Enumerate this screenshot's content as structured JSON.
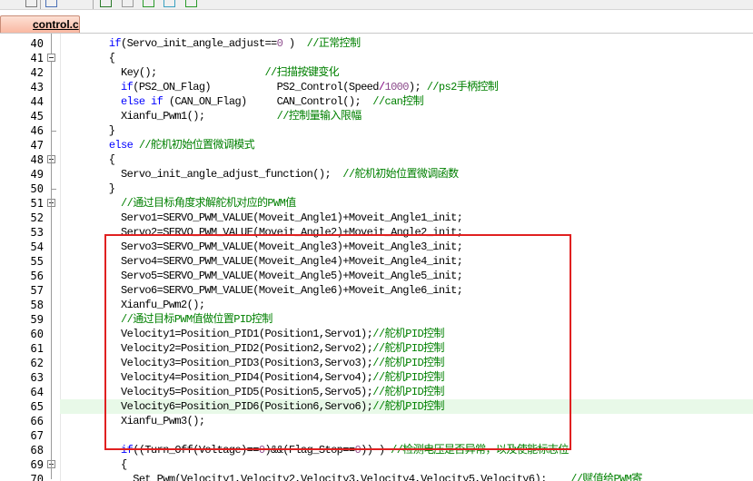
{
  "toolbar": {
    "icons": [
      "checkbox-dropdown-icon",
      "build-icon",
      "window-icon",
      "undo-icon",
      "download-icon",
      "debug-icon",
      "check-icon"
    ]
  },
  "tab": {
    "label": "control.c"
  },
  "accent_colors": {
    "keyword": "#0000ff",
    "comment": "#008000",
    "number": "#8b4a8b",
    "annotation": "#e02020",
    "current_line": "#e8f9e8"
  },
  "editor": {
    "lines": [
      {
        "n": "40",
        "tokens": [
          [
            "        ",
            ""
          ],
          [
            "if",
            "kw"
          ],
          [
            "(Servo_init_angle_adjust==",
            ""
          ],
          [
            "0",
            "nm"
          ],
          [
            " )  ",
            ""
          ],
          [
            "//正常控制",
            "cm"
          ]
        ]
      },
      {
        "n": "41",
        "tokens": [
          [
            "        {",
            ""
          ]
        ]
      },
      {
        "n": "42",
        "tokens": [
          [
            "          Key();                  ",
            ""
          ],
          [
            "//扫描按键变化",
            "cm"
          ]
        ]
      },
      {
        "n": "43",
        "tokens": [
          [
            "          ",
            ""
          ],
          [
            "if",
            "kw"
          ],
          [
            "(PS2_ON_Flag)           PS2_Control(Speed",
            ""
          ],
          [
            "/",
            "pn"
          ],
          [
            "1000",
            "nm"
          ],
          [
            "); ",
            ""
          ],
          [
            "//ps2手柄控制",
            "cm"
          ]
        ]
      },
      {
        "n": "44",
        "tokens": [
          [
            "          ",
            ""
          ],
          [
            "else",
            "kw"
          ],
          [
            " ",
            ""
          ],
          [
            "if",
            "kw"
          ],
          [
            " (CAN_ON_Flag)     CAN_Control();  ",
            ""
          ],
          [
            "//can控制",
            "cm"
          ]
        ]
      },
      {
        "n": "45",
        "tokens": [
          [
            "          Xianfu_Pwm1();            ",
            ""
          ],
          [
            "//控制量输入限幅",
            "cm"
          ]
        ]
      },
      {
        "n": "46",
        "tokens": [
          [
            "        }",
            ""
          ]
        ]
      },
      {
        "n": "47",
        "tokens": [
          [
            "        ",
            ""
          ],
          [
            "else",
            "kw"
          ],
          [
            " ",
            ""
          ],
          [
            "//舵机初始位置微调模式",
            "cm"
          ]
        ]
      },
      {
        "n": "48",
        "tokens": [
          [
            "        {",
            ""
          ]
        ]
      },
      {
        "n": "49",
        "tokens": [
          [
            "          Servo_init_angle_adjust_function();  ",
            ""
          ],
          [
            "//舵机初始位置微调函数",
            "cm"
          ]
        ]
      },
      {
        "n": "50",
        "tokens": [
          [
            "        }",
            ""
          ]
        ]
      },
      {
        "n": "51",
        "tokens": [
          [
            "          ",
            ""
          ],
          [
            "//通过目标角度求解舵机对应的PWM值",
            "cm"
          ]
        ]
      },
      {
        "n": "52",
        "tokens": [
          [
            "          Servo1=SERVO_PWM_VALUE(Moveit_Angle1)+Moveit_Angle1_init;",
            ""
          ]
        ]
      },
      {
        "n": "53",
        "tokens": [
          [
            "          Servo2=SERVO_PWM_VALUE(Moveit_Angle2)+Moveit_Angle2_init;",
            ""
          ]
        ]
      },
      {
        "n": "54",
        "tokens": [
          [
            "          Servo3=SERVO_PWM_VALUE(Moveit_Angle3)+Moveit_Angle3_init;",
            ""
          ]
        ]
      },
      {
        "n": "55",
        "tokens": [
          [
            "          Servo4=SERVO_PWM_VALUE(Moveit_Angle4)+Moveit_Angle4_init;",
            ""
          ]
        ]
      },
      {
        "n": "56",
        "tokens": [
          [
            "          Servo5=SERVO_PWM_VALUE(Moveit_Angle5)+Moveit_Angle5_init;",
            ""
          ]
        ]
      },
      {
        "n": "57",
        "tokens": [
          [
            "          Servo6=SERVO_PWM_VALUE(Moveit_Angle6)+Moveit_Angle6_init;",
            ""
          ]
        ]
      },
      {
        "n": "58",
        "tokens": [
          [
            "          Xianfu_Pwm2();",
            ""
          ]
        ]
      },
      {
        "n": "59",
        "tokens": [
          [
            "          ",
            ""
          ],
          [
            "//通过目标PWM值做位置PID控制",
            "cm"
          ]
        ]
      },
      {
        "n": "60",
        "tokens": [
          [
            "          Velocity1=Position_PID1(Position1,Servo1);",
            ""
          ],
          [
            "//舵机PID控制",
            "cm"
          ]
        ]
      },
      {
        "n": "61",
        "tokens": [
          [
            "          Velocity2=Position_PID2(Position2,Servo2);",
            ""
          ],
          [
            "//舵机PID控制",
            "cm"
          ]
        ]
      },
      {
        "n": "62",
        "tokens": [
          [
            "          Velocity3=Position_PID3(Position3,Servo3);",
            ""
          ],
          [
            "//舵机PID控制",
            "cm"
          ]
        ]
      },
      {
        "n": "63",
        "tokens": [
          [
            "          Velocity4=Position_PID4(Position4,Servo4);",
            ""
          ],
          [
            "//舵机PID控制",
            "cm"
          ]
        ]
      },
      {
        "n": "64",
        "tokens": [
          [
            "          Velocity5=Position_PID5(Position5,Servo5);",
            ""
          ],
          [
            "//舵机PID控制",
            "cm"
          ]
        ]
      },
      {
        "n": "65",
        "hl": true,
        "tokens": [
          [
            "          Velocity6=Position_PID6(Position6,Servo6);",
            ""
          ],
          [
            "//舵机PID控制",
            "cm"
          ]
        ]
      },
      {
        "n": "66",
        "tokens": [
          [
            "          Xianfu_Pwm3();",
            ""
          ]
        ]
      },
      {
        "n": "67",
        "tokens": [
          [
            "",
            ""
          ]
        ]
      },
      {
        "n": "68",
        "tokens": [
          [
            "          ",
            ""
          ],
          [
            "if",
            "kw"
          ],
          [
            "((Turn_Off(Voltage)==",
            ""
          ],
          [
            "0",
            "nm"
          ],
          [
            ")&&(Flag_Stop==",
            ""
          ],
          [
            "0",
            "nm"
          ],
          [
            ")) ) ",
            ""
          ],
          [
            "//检测电压是否异常，以及使能标志位",
            "cm"
          ]
        ]
      },
      {
        "n": "69",
        "tokens": [
          [
            "          {",
            ""
          ]
        ]
      },
      {
        "n": "70",
        "tokens": [
          [
            "            Set_Pwm(Velocity1,Velocity2,Velocity3,Velocity4,Velocity5,Velocity6);    ",
            ""
          ],
          [
            "//赋值给PWM寄",
            "cm"
          ]
        ]
      }
    ],
    "folds": [
      "41",
      "48",
      "51",
      "69"
    ]
  }
}
